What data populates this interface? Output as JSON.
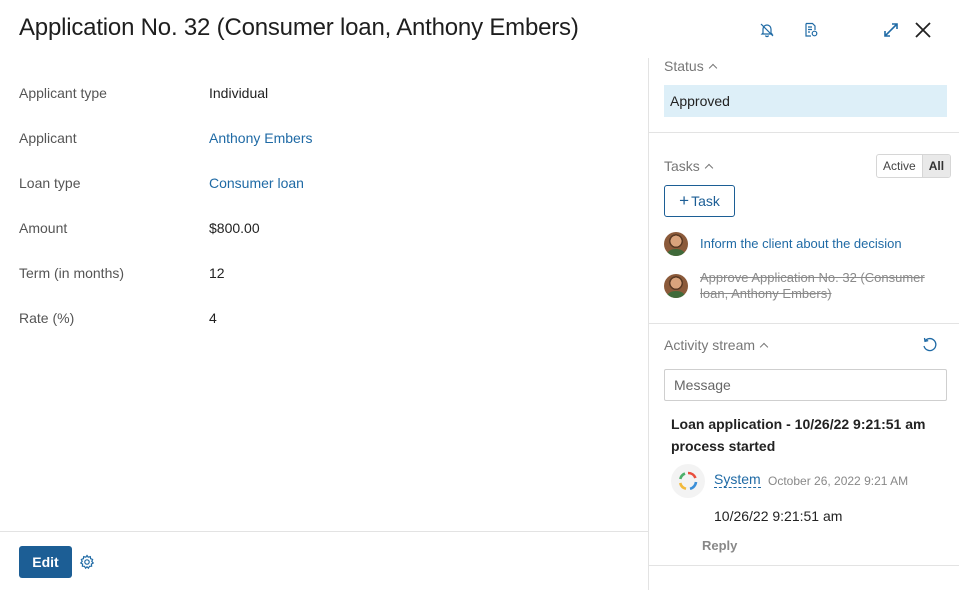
{
  "header": {
    "title": "Application No. 32 (Consumer loan, Anthony Embers)",
    "icons": [
      "bell-off-icon",
      "document-settings-icon",
      "expand-icon",
      "close-icon"
    ]
  },
  "fields": [
    {
      "label": "Applicant type",
      "value": "Individual",
      "link": false
    },
    {
      "label": "Applicant",
      "value": "Anthony Embers",
      "link": true
    },
    {
      "label": "Loan type",
      "value": "Consumer loan",
      "link": true
    },
    {
      "label": "Amount",
      "value": "$800.00",
      "link": false
    },
    {
      "label": "Term (in months)",
      "value": "12",
      "link": false
    },
    {
      "label": "Rate (%)",
      "value": "4",
      "link": false
    }
  ],
  "footer": {
    "edit_label": "Edit"
  },
  "sidebar": {
    "status": {
      "title": "Status",
      "value": "Approved"
    },
    "tasks": {
      "title": "Tasks",
      "filter_active": "Active",
      "filter_all": "All",
      "selected_filter": "All",
      "add_label": "Task",
      "items": [
        {
          "text": "Inform the client about the decision",
          "done": false
        },
        {
          "text": "Approve Application No. 32 (Consumer loan, Anthony Embers)",
          "done": true
        }
      ]
    },
    "activity": {
      "title": "Activity stream",
      "message_placeholder": "Message",
      "post": {
        "title": "Loan application - 10/26/22 9:21:51 am process started",
        "author": "System",
        "date": "October 26, 2022 9:21 AM",
        "body": "10/26/22 9:21:51 am",
        "reply_label": "Reply"
      }
    }
  },
  "colors": {
    "accent": "#1c5e95",
    "link": "#1f6aa5",
    "status_bg": "#ddeff8"
  }
}
